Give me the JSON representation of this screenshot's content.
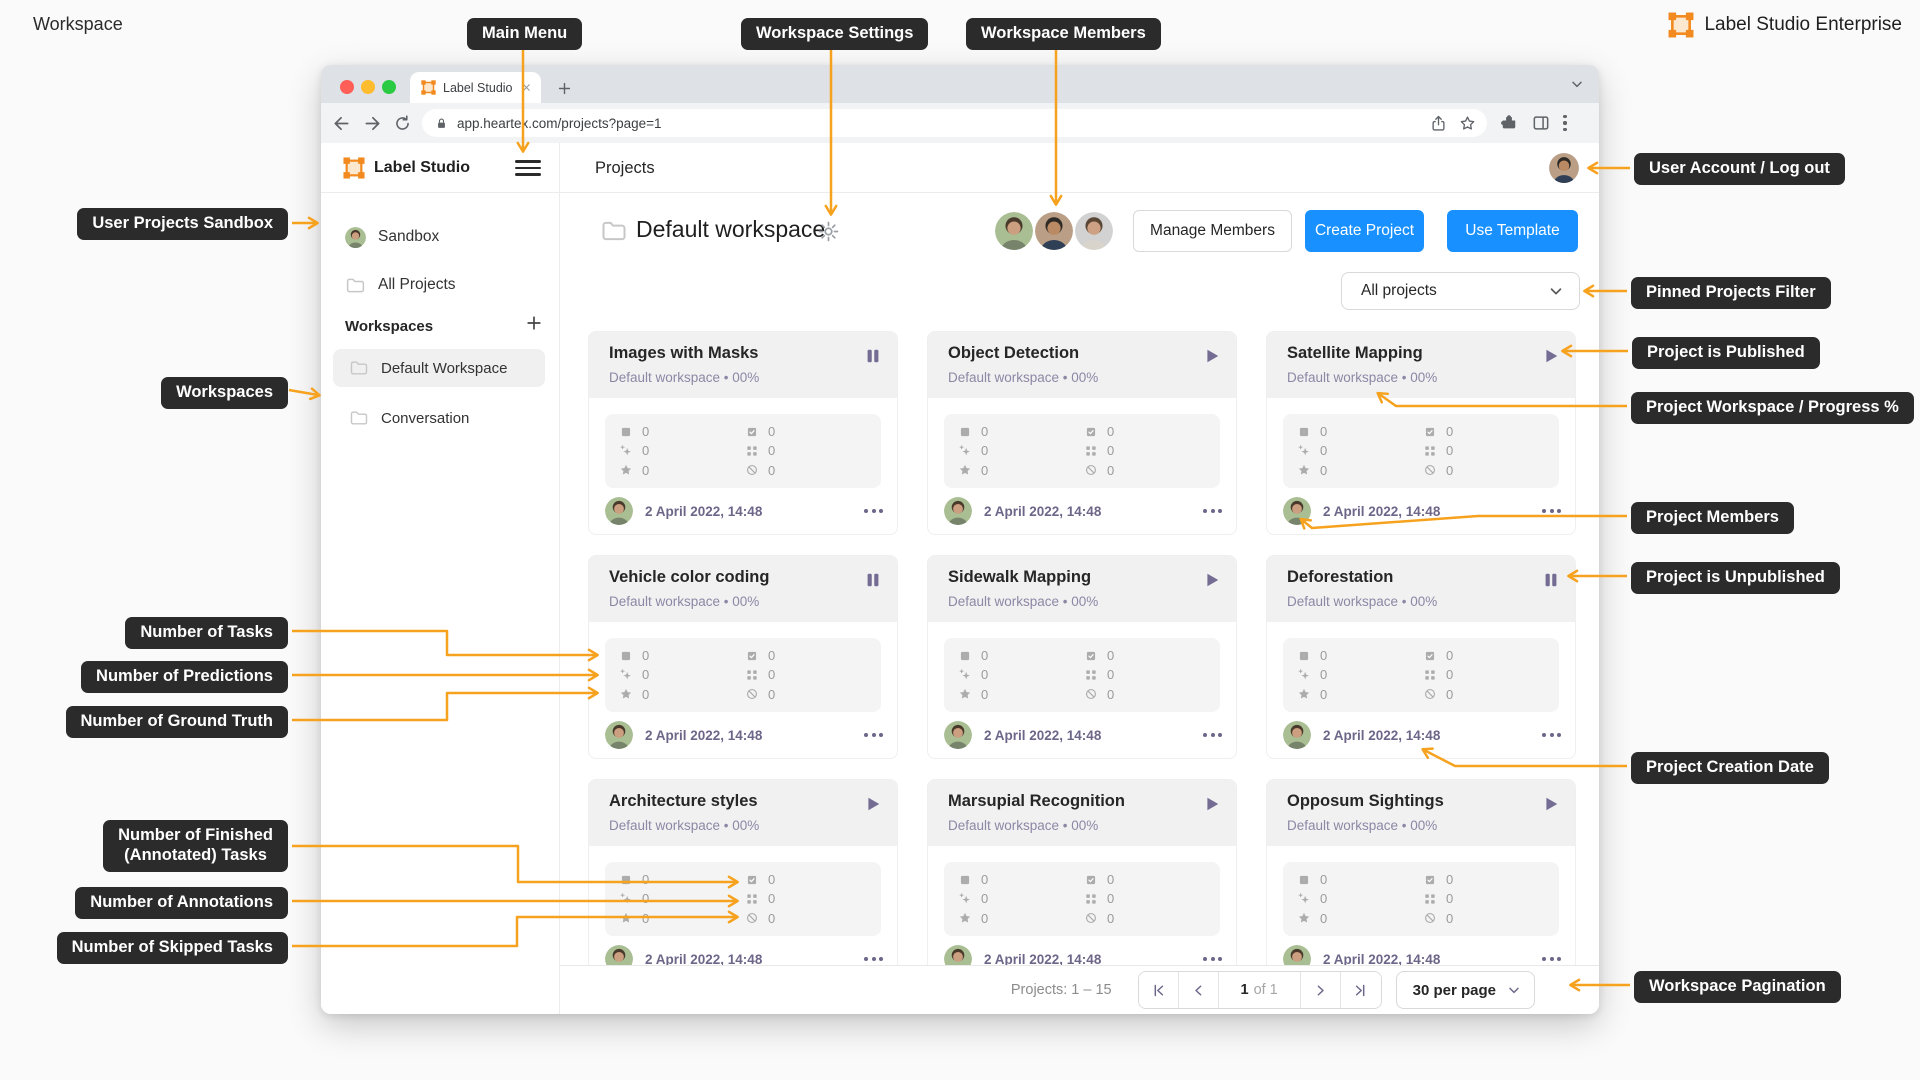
{
  "page": {
    "title": "Workspace"
  },
  "brand": {
    "name": "Label Studio Enterprise",
    "orange": "#F28A1F"
  },
  "colors": {
    "accent_orange": "#F6A21E",
    "primary_blue": "#1890FF",
    "callout_bg": "#2B2B2B",
    "muted_purple": "#756C93"
  },
  "icons": {
    "brand_logo": "bounding-box-handles",
    "workspace_settings": "gear",
    "main_menu": "hamburger",
    "project_status_published": "play-triangle",
    "project_status_unpublished": "pause-bars",
    "tasks": "filled-square",
    "finished_tasks": "check-square",
    "predictions": "sparkle-plus",
    "annotations": "corner-dots",
    "ground_truth": "star",
    "skipped_tasks": "slashed-circle"
  },
  "callouts": {
    "main_menu": "Main Menu",
    "workspace_settings": "Workspace Settings",
    "workspace_members": "Workspace Members",
    "user_account": "User Account / Log out",
    "user_projects_sandbox": "User Projects Sandbox",
    "pinned_projects_filter": "Pinned Projects Filter",
    "project_is_published": "Project is Published",
    "project_workspace_progress": "Project Workspace / Progress %",
    "workspaces": "Workspaces",
    "project_members": "Project Members",
    "project_is_unpublished": "Project is Unpublished",
    "number_of_tasks": "Number of Tasks",
    "number_of_predictions": "Number of Predictions",
    "number_of_ground_truth": "Number of Ground Truth",
    "project_creation_date": "Project Creation Date",
    "number_of_finished_1": "Number of Finished",
    "number_of_finished_2": "(Annotated) Tasks",
    "number_of_annotations": "Number of Annotations",
    "number_of_skipped_tasks": "Number of Skipped Tasks",
    "workspace_pagination": "Workspace Pagination"
  },
  "browser": {
    "tab_title": "Label Studio",
    "url": "app.heartex.com/projects?page=1"
  },
  "app": {
    "sidebar": {
      "logo_text": "Label Studio",
      "sandbox_label": "Sandbox",
      "all_projects_label": "All Projects",
      "workspaces_header": "Workspaces",
      "items": [
        {
          "label": "Default Workspace",
          "selected": true
        },
        {
          "label": "Conversation",
          "selected": false
        }
      ]
    },
    "header": {
      "page_title": "Projects"
    },
    "main": {
      "workspace_title": "Default workspace",
      "manage_members_label": "Manage Members",
      "create_project_label": "Create Project",
      "use_template_label": "Use Template",
      "filter_label": "All projects"
    },
    "footer": {
      "range_label": "Projects: 1 – 15",
      "page_current": "1",
      "page_of": "of 1",
      "per_page_label": "30 per page"
    }
  },
  "projects": {
    "cards": [
      {
        "title": "Images with Masks",
        "status": "paused",
        "subtitle": "Default workspace • 00%",
        "date": "2 April 2022, 14:48",
        "stats": {
          "tasks": "0",
          "finished_tasks": "0",
          "predictions": "0",
          "annotations": "0",
          "ground_truth": "0",
          "skipped": "0"
        }
      },
      {
        "title": "Object Detection",
        "status": "published",
        "subtitle": "Default workspace • 00%",
        "date": "2 April 2022, 14:48",
        "stats": {
          "tasks": "0",
          "finished_tasks": "0",
          "predictions": "0",
          "annotations": "0",
          "ground_truth": "0",
          "skipped": "0"
        }
      },
      {
        "title": "Satellite Mapping",
        "status": "published",
        "subtitle": "Default workspace • 00%",
        "date": "2 April 2022, 14:48",
        "stats": {
          "tasks": "0",
          "finished_tasks": "0",
          "predictions": "0",
          "annotations": "0",
          "ground_truth": "0",
          "skipped": "0"
        }
      },
      {
        "title": "Vehicle color coding",
        "status": "paused",
        "subtitle": "Default workspace • 00%",
        "date": "2 April 2022, 14:48",
        "stats": {
          "tasks": "0",
          "finished_tasks": "0",
          "predictions": "0",
          "annotations": "0",
          "ground_truth": "0",
          "skipped": "0"
        }
      },
      {
        "title": "Sidewalk Mapping",
        "status": "published",
        "subtitle": "Default workspace • 00%",
        "date": "2 April 2022, 14:48",
        "stats": {
          "tasks": "0",
          "finished_tasks": "0",
          "predictions": "0",
          "annotations": "0",
          "ground_truth": "0",
          "skipped": "0"
        }
      },
      {
        "title": "Deforestation",
        "status": "paused",
        "subtitle": "Default workspace • 00%",
        "date": "2 April 2022, 14:48",
        "stats": {
          "tasks": "0",
          "finished_tasks": "0",
          "predictions": "0",
          "annotations": "0",
          "ground_truth": "0",
          "skipped": "0"
        }
      },
      {
        "title": "Architecture styles",
        "status": "published",
        "subtitle": "Default workspace • 00%",
        "date": "2 April 2022, 14:48",
        "stats": {
          "tasks": "0",
          "finished_tasks": "0",
          "predictions": "0",
          "annotations": "0",
          "ground_truth": "0",
          "skipped": "0"
        }
      },
      {
        "title": "Marsupial Recognition",
        "status": "published",
        "subtitle": "Default workspace • 00%",
        "date": "2 April 2022, 14:48",
        "stats": {
          "tasks": "0",
          "finished_tasks": "0",
          "predictions": "0",
          "annotations": "0",
          "ground_truth": "0",
          "skipped": "0"
        }
      },
      {
        "title": "Opposum Sightings",
        "status": "published",
        "subtitle": "Default workspace • 00%",
        "date": "2 April 2022, 14:48",
        "stats": {
          "tasks": "0",
          "finished_tasks": "0",
          "predictions": "0",
          "annotations": "0",
          "ground_truth": "0",
          "skipped": "0"
        }
      }
    ]
  }
}
